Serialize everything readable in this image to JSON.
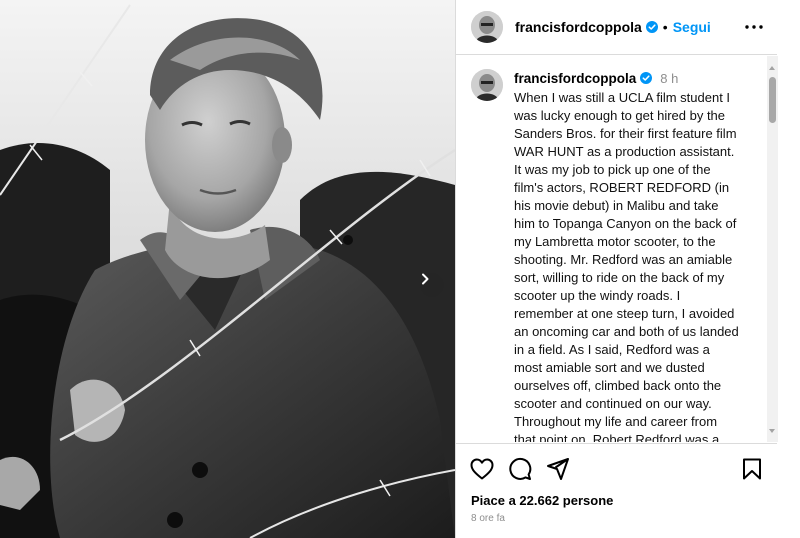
{
  "post": {
    "username": "francisfordcoppola",
    "follow_label": "Segui",
    "dot": "•",
    "caption_time": "8 h",
    "caption_text": "When I was still a UCLA film student I was lucky enough to get hired by the Sanders Bros. for their first feature film WAR HUNT as a production assistant. It was my job to pick up one of the film's actors, ROBERT REDFORD (in his movie debut) in Malibu and take him to Topanga Canyon on the back of my Lambretta motor scooter, to the shooting. Mr. Redford was an amiable sort, willing to ride on the back of my scooter up the windy roads. I remember at one steep turn, I avoided an oncoming car and both of us landed in a field. As I said, Redford was a most amiable sort and we dusted ourselves off, climbed back onto the scooter and continued on our way. Throughout my life and career from that point on, Robert Redford was a most kind and generous person to me. I remember",
    "likes_text": "Piace a 22.662 persone",
    "posted_ago": "8 ore fa"
  },
  "icons": {
    "verified": "verified-badge-icon",
    "more": "more-options-icon",
    "like": "heart-icon",
    "comment": "comment-icon",
    "share": "share-icon",
    "save": "bookmark-icon",
    "next": "chevron-right-icon"
  },
  "colors": {
    "accent": "#0095f6",
    "secondary_text": "#8e8e8e",
    "border": "#dbdbdb"
  }
}
